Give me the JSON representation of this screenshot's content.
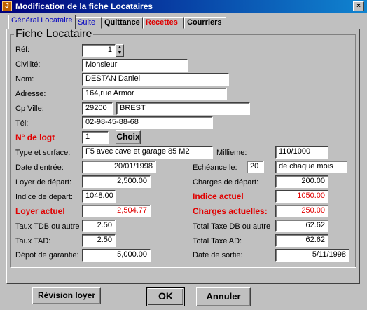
{
  "window": {
    "title": "Modification de la fiche Locataires",
    "close": "×",
    "icon": "J"
  },
  "tabs": [
    {
      "label": "Général Locataire",
      "color": "#0000c0"
    },
    {
      "label": "Suite",
      "color": "#0000c0"
    },
    {
      "label": "Quittance",
      "color": "#000000"
    },
    {
      "label": "Recettes",
      "color": "#e00000"
    },
    {
      "label": "Courriers",
      "color": "#000000"
    }
  ],
  "group": {
    "title": "Fiche Locataire"
  },
  "fields": {
    "ref": {
      "label": "Réf:",
      "value": "1"
    },
    "civilite": {
      "label": "Civilité:",
      "value": "Monsieur"
    },
    "nom": {
      "label": "Nom:",
      "value": "DESTAN  Daniel"
    },
    "adresse": {
      "label": "Adresse:",
      "value": "164,rue Armor"
    },
    "cp_ville": {
      "label": "Cp Ville:",
      "cp": "29200",
      "ville": "BREST"
    },
    "tel": {
      "label": "Tél:",
      "value": "02-98-45-88-68"
    },
    "logt": {
      "label": "N° de logt",
      "value": "1",
      "button": "Choix"
    },
    "type_surface": {
      "label": "Type et surface:",
      "value": "F5  avec cave et garage 85 M2"
    },
    "millieme": {
      "label": "Millieme:",
      "value": "110/1000"
    },
    "date_entree": {
      "label": "Date d'entrée:",
      "value": "20/01/1998"
    },
    "echeance": {
      "label": "Echéance le:",
      "value": "20",
      "suffix": "de chaque mois"
    },
    "loyer_depart": {
      "label": "Loyer de départ:",
      "value": "2,500.00"
    },
    "charges_depart": {
      "label": "Charges de départ:",
      "value": "200.00"
    },
    "indice_depart": {
      "label": "Indice de départ:",
      "value": "1048.00"
    },
    "indice_actuel": {
      "label": "Indice actuel",
      "value": "1050.00"
    },
    "loyer_actuel": {
      "label": "Loyer actuel",
      "value": "2,504.77"
    },
    "charges_actuelles": {
      "label": "Charges actuelles:",
      "value": "250.00"
    },
    "taux_tdb": {
      "label": "Taux TDB ou autre",
      "value": "2.50"
    },
    "total_taxe_db": {
      "label": "Total Taxe DB ou autre",
      "value": "62.62"
    },
    "taux_tad": {
      "label": "Taux TAD:",
      "value": "2.50"
    },
    "total_taxe_ad": {
      "label": "Total Taxe AD:",
      "value": "62.62"
    },
    "depot_garantie": {
      "label": "Dépot de garantie:",
      "value": "5,000.00"
    },
    "date_sortie": {
      "label": "Date de sortie:",
      "value": "5/11/1998"
    }
  },
  "buttons": {
    "revision": "Révision loyer",
    "ok": "OK",
    "annuler": "Annuler"
  }
}
